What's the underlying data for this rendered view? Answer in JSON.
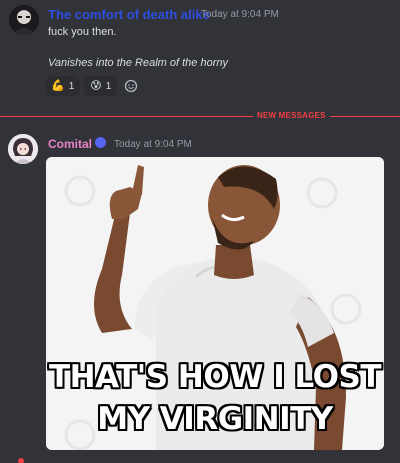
{
  "message1": {
    "username": "The comfort of death alike",
    "timestamp": "Today at 9:04 PM",
    "line1": "fuck you then.",
    "line2": "Vanishes into the Realm of the horny",
    "reactions": [
      {
        "emoji": "💪",
        "count": "1"
      },
      {
        "emoji": "😰",
        "count": "1"
      }
    ],
    "add_reaction_icon": "add-reaction-icon"
  },
  "divider": {
    "label": "NEW MESSAGES",
    "color": "#f23f43"
  },
  "message2": {
    "username": "Comital",
    "timestamp": "Today at 9:04 PM",
    "meme": {
      "caption_line1": "THAT'S HOW I LOST",
      "caption_line2": "MY VIRGINITY"
    }
  },
  "colors": {
    "background": "#313338",
    "username1": "#2e4fe0",
    "username2": "#e882c8",
    "timestamp": "#949ba4"
  }
}
